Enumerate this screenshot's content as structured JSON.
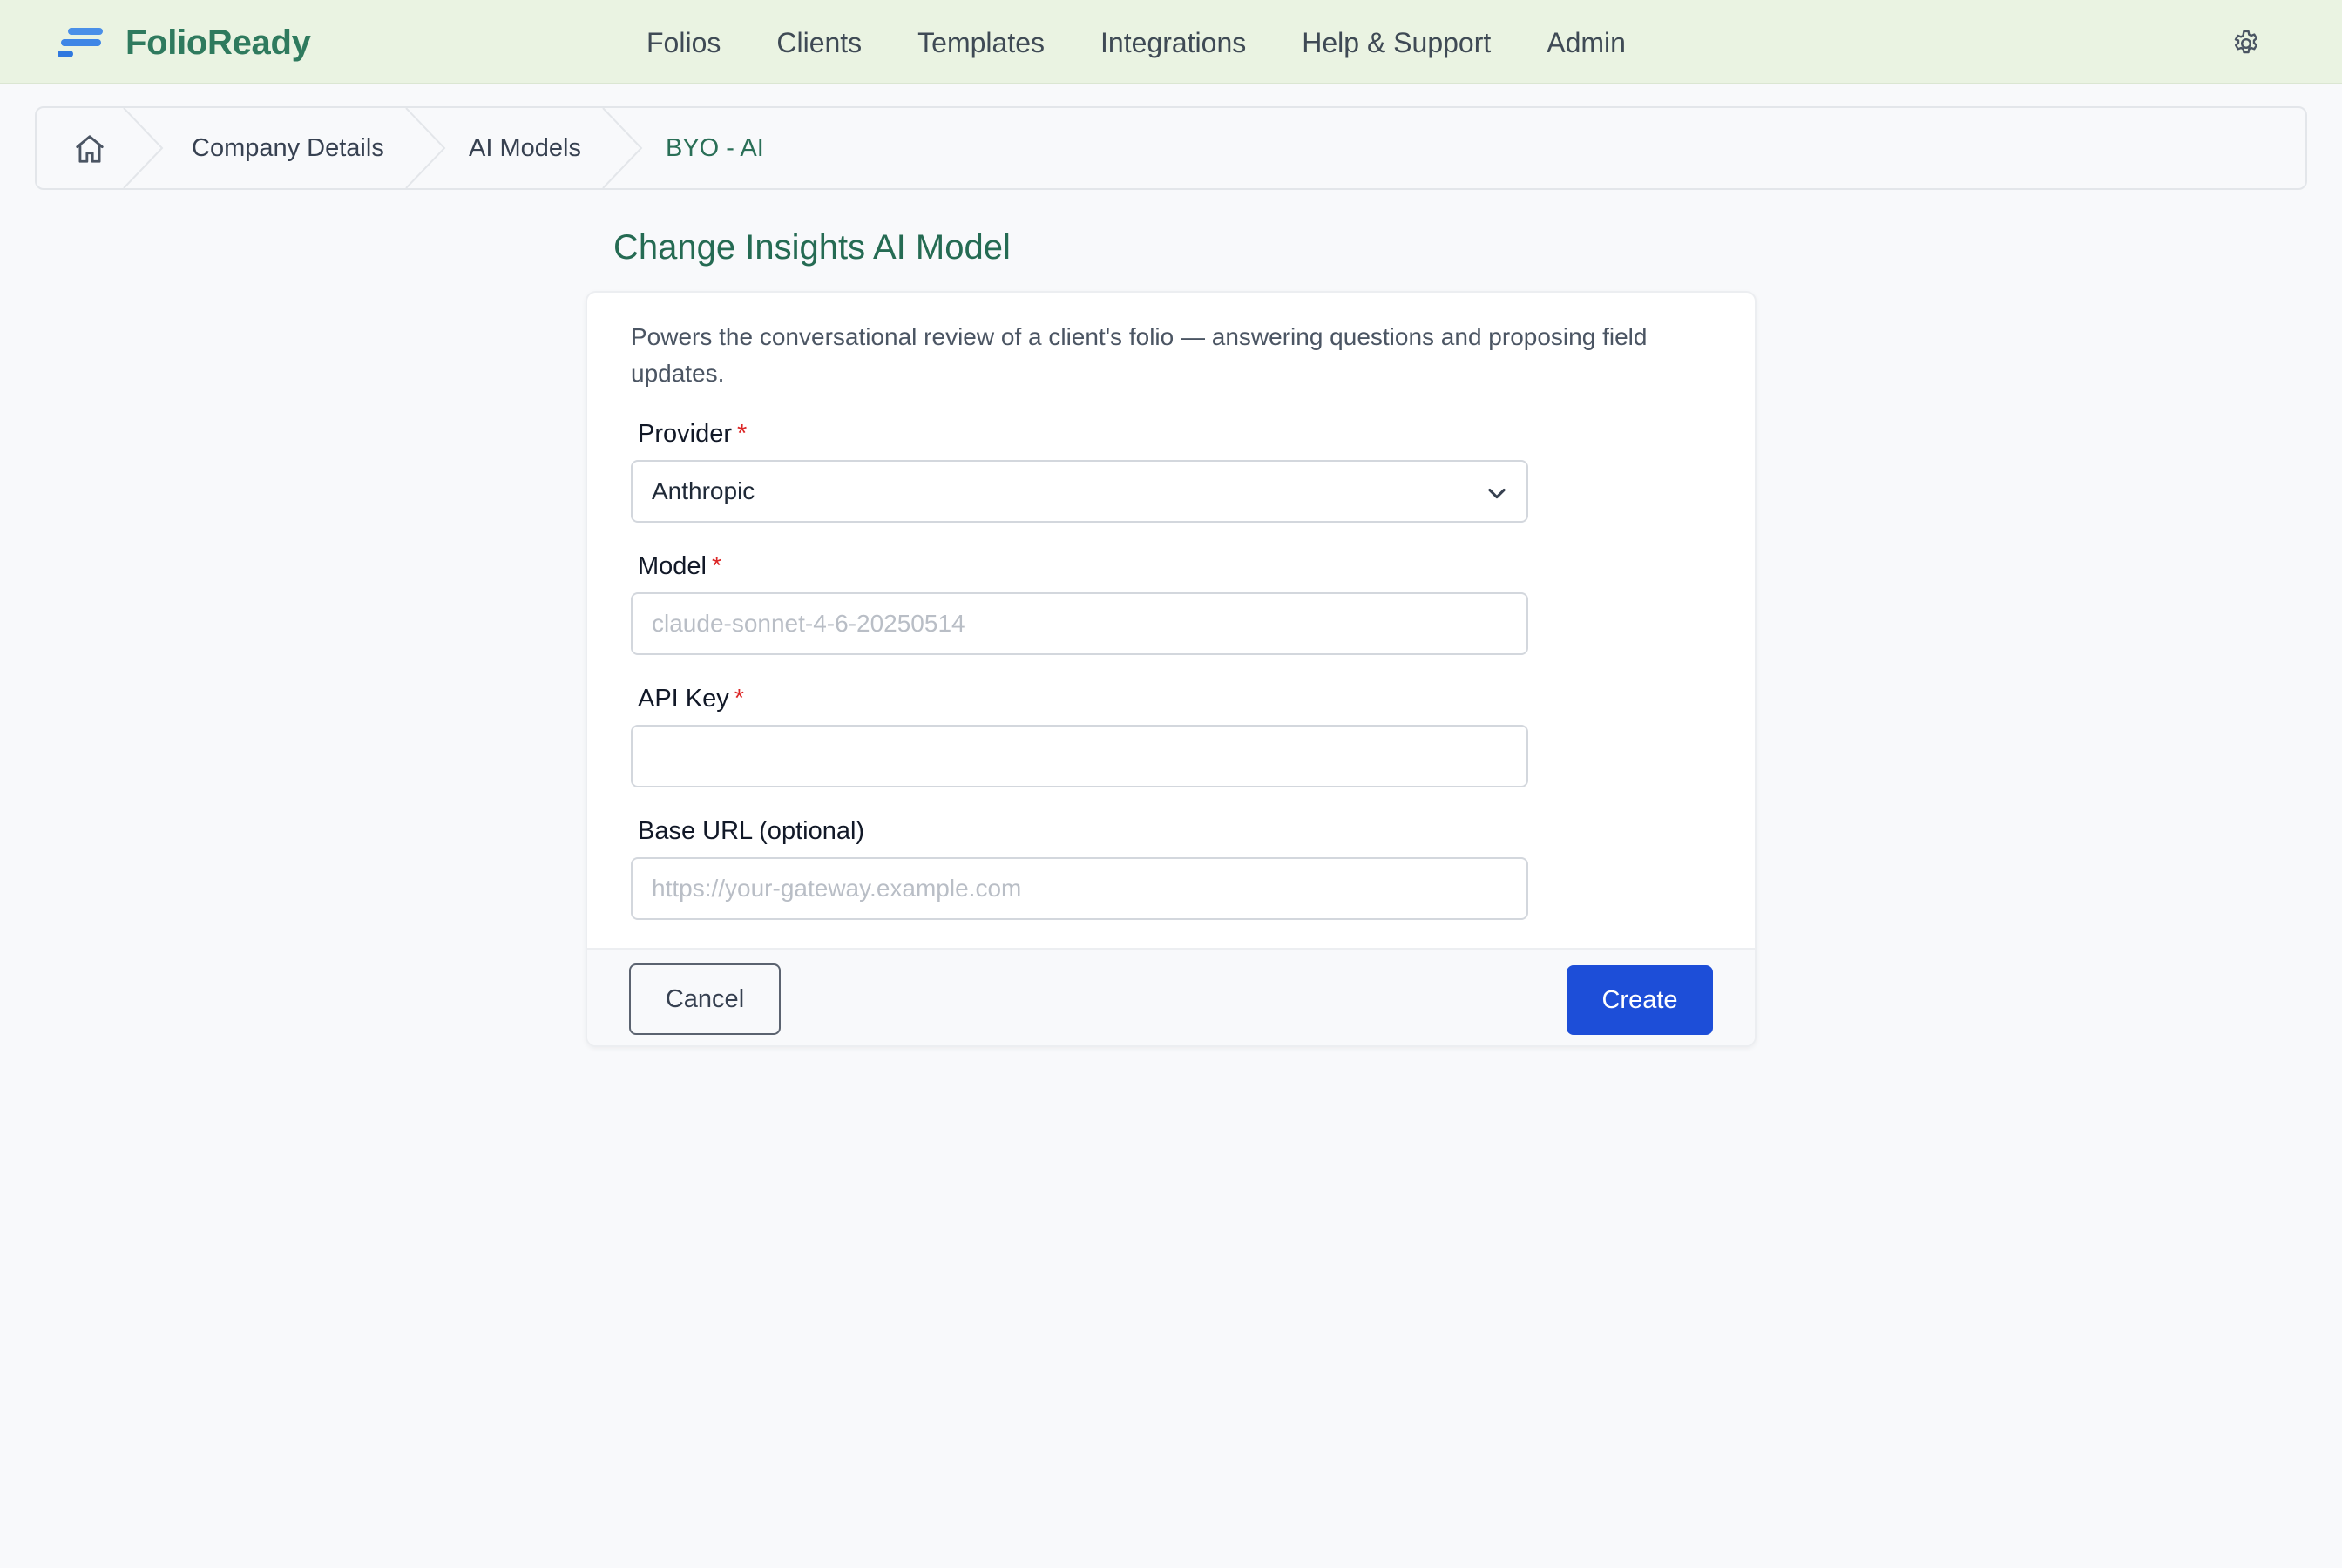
{
  "app": {
    "brand_name": "FolioReady",
    "brand_color": "#2f7a5e"
  },
  "nav": {
    "items": [
      {
        "label": "Folios"
      },
      {
        "label": "Clients"
      },
      {
        "label": "Templates"
      },
      {
        "label": "Integrations"
      },
      {
        "label": "Help & Support"
      },
      {
        "label": "Admin"
      }
    ],
    "settings_icon": "gear-icon"
  },
  "breadcrumb": {
    "home_icon": "home-icon",
    "items": [
      {
        "label": "Company Details"
      },
      {
        "label": "AI Models"
      },
      {
        "label": "BYO - AI",
        "active": true
      }
    ]
  },
  "page": {
    "title": "Change Insights AI Model"
  },
  "form": {
    "description": "Powers the conversational review of a client's folio — answering questions and proposing field updates.",
    "required_marker": "*",
    "provider": {
      "label": "Provider",
      "value": "Anthropic"
    },
    "model": {
      "label": "Model",
      "value": "",
      "placeholder": "claude-sonnet-4-6-20250514"
    },
    "api_key": {
      "label": "API Key",
      "value": "",
      "placeholder": ""
    },
    "base_url": {
      "label": "Base URL (optional)",
      "value": "",
      "placeholder": "https://your-gateway.example.com"
    },
    "cancel_label": "Cancel",
    "create_label": "Create"
  },
  "colors": {
    "accent": "#1d4ed8",
    "required": "#dc2626",
    "nav_bg": "#eaf3e2",
    "title": "#256b53"
  }
}
